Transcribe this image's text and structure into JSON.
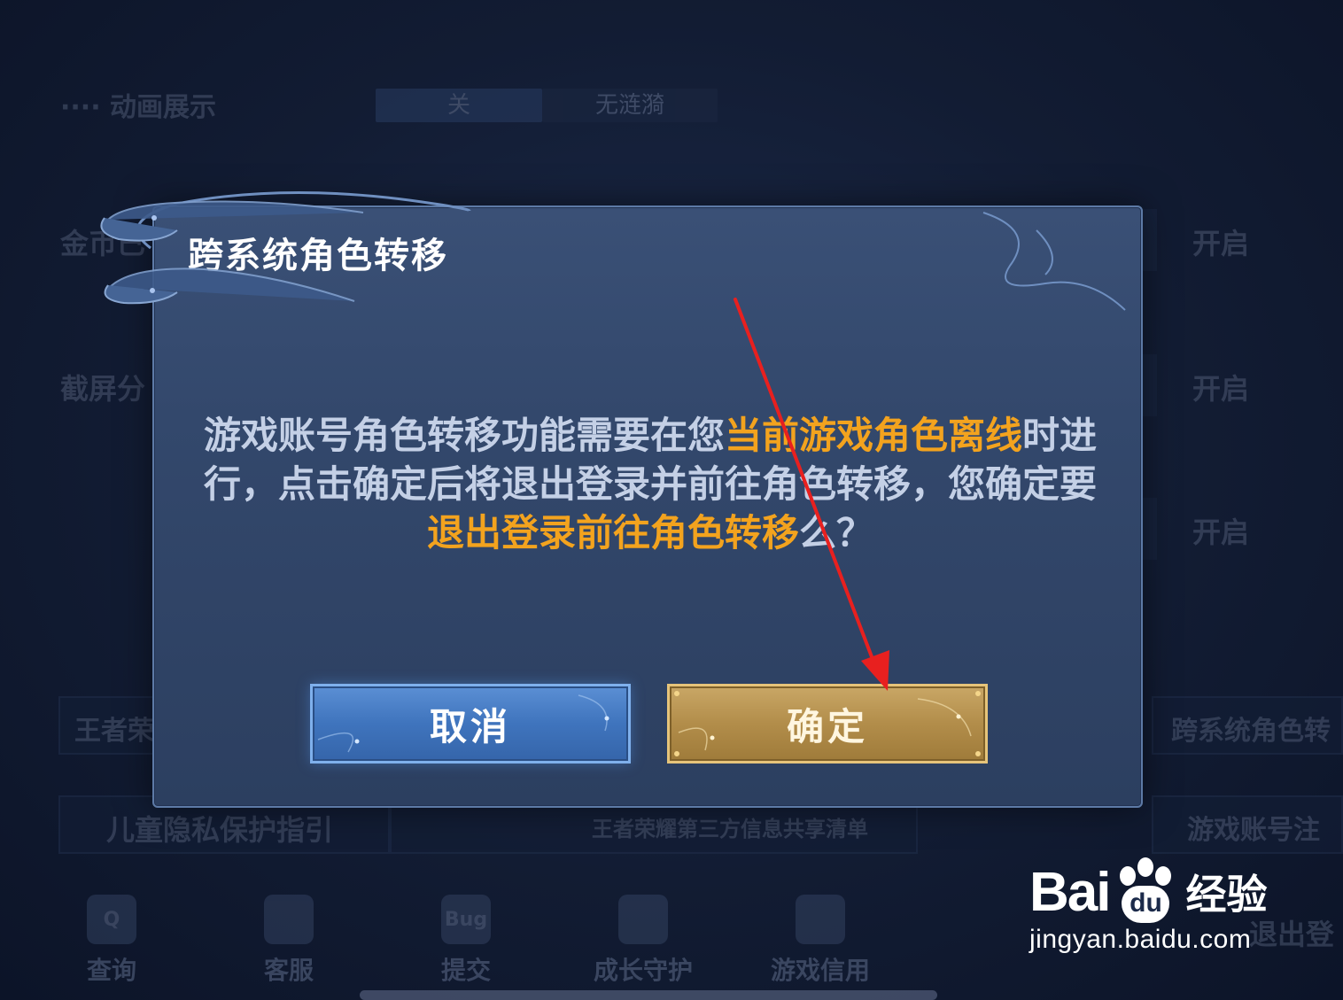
{
  "background": {
    "top_row_label": "···· 动画展示",
    "top_toggle_on": "关",
    "top_toggle_off": "无涟漪",
    "rows": [
      {
        "label": "金币已",
        "value": "开启"
      },
      {
        "label": "截屏分",
        "value": "开启"
      },
      {
        "label": "",
        "value": "开启"
      }
    ],
    "links_row1": {
      "left": "王者荣",
      "right": "跨系统角色转"
    },
    "links_row2": {
      "left": "儿童隐私保护指引",
      "center": "王者荣耀第三方信息共享清单",
      "right": "游戏账号注"
    },
    "dock": [
      {
        "icon": "search-doc-icon",
        "glyph": "Q",
        "label": "查询"
      },
      {
        "icon": "cat-service-icon",
        "glyph": "",
        "label": "客服"
      },
      {
        "icon": "bug-icon",
        "glyph": "Bug",
        "label": "提交"
      },
      {
        "icon": "growth-guard-icon",
        "glyph": "",
        "label": "成长守护"
      },
      {
        "icon": "credit-shield-icon",
        "glyph": "",
        "label": "游戏信用"
      }
    ],
    "logout_label": "退出登"
  },
  "dialog": {
    "title": "跨系统角色转移",
    "message": {
      "p1": "游戏账号角色转移功能需要在您",
      "h1": "当前游戏角色离线",
      "p2": "时进行，点击确定后将退出登录并前往角色转移，您确定要",
      "h2": "退出登录前往角色转移",
      "p3": "么？"
    },
    "cancel_label": "取消",
    "confirm_label": "确定"
  },
  "watermark": {
    "brand_left": "Bai",
    "brand_paw_text": "du",
    "brand_right": "经验",
    "url": "jingyan.baidu.com"
  },
  "colors": {
    "highlight": "#f3a31e",
    "arrow": "#e8201f"
  }
}
